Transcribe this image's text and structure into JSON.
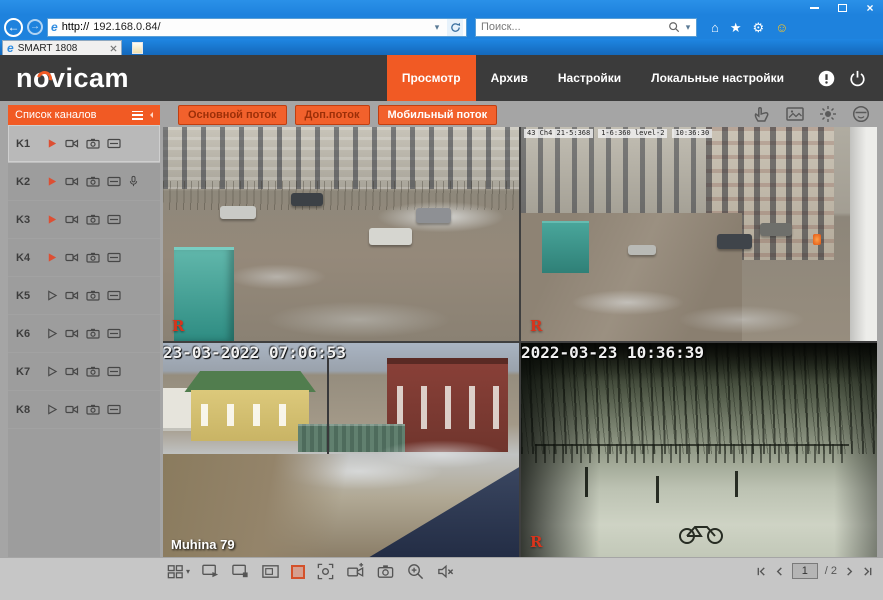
{
  "browser": {
    "url_scheme": "http://",
    "url_host": "192.168.0.84/",
    "tab_title": "SMART 1808",
    "search_placeholder": "Поиск..."
  },
  "header": {
    "logo_pre": "n",
    "logo_o": "o",
    "logo_post": "vicam",
    "nav": [
      {
        "label": "Просмотр"
      },
      {
        "label": "Архив"
      },
      {
        "label": "Настройки"
      },
      {
        "label": "Локальные настройки"
      }
    ]
  },
  "sidebar": {
    "title": "Список каналов",
    "channels": [
      {
        "name": "K1"
      },
      {
        "name": "K2"
      },
      {
        "name": "K3"
      },
      {
        "name": "K4"
      },
      {
        "name": "K5"
      },
      {
        "name": "K6"
      },
      {
        "name": "K7"
      },
      {
        "name": "K8"
      }
    ]
  },
  "stream_buttons": [
    {
      "label": "Основной поток"
    },
    {
      "label": "Доп.поток"
    },
    {
      "label": "Мобильный поток"
    }
  ],
  "cameras": {
    "cam2_osd": [
      "43 Ch4 21-5:368",
      "1-6:360 level-2",
      "10:36:30"
    ],
    "cam3_timestamp": "23-03-2022 07:06:53",
    "cam3_label": "Muhina 79",
    "cam4_timestamp": "2022-03-23 10:36:39",
    "record_indicator": "R"
  },
  "pager": {
    "current": "1",
    "total_label": "/ 2"
  },
  "colors": {
    "accent": "#f15a24",
    "selected_border": "#2bd9d2",
    "ie_blue": "#1e82dd"
  }
}
